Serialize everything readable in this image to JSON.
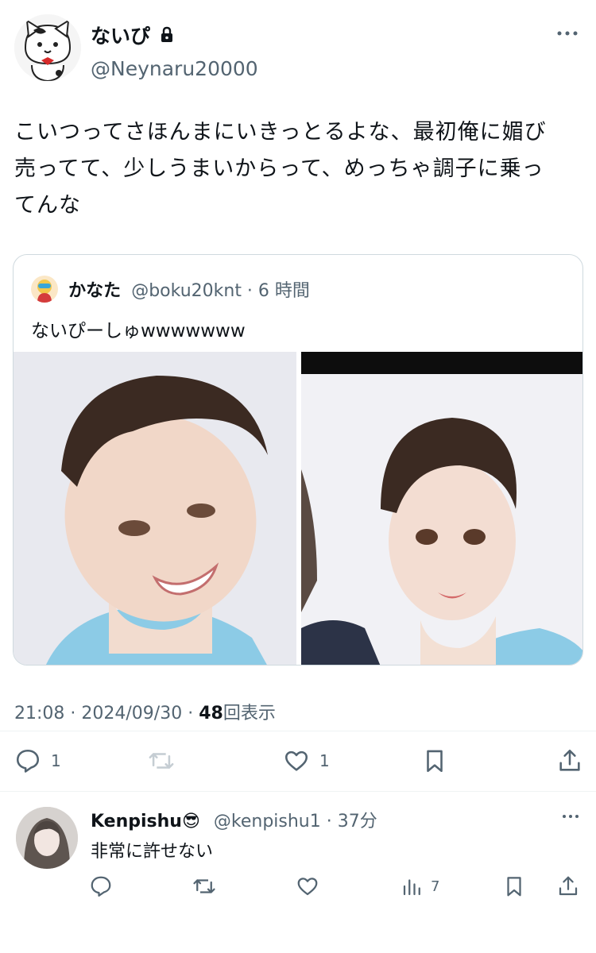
{
  "post": {
    "display_name": "ないぴ",
    "handle": "@Neynaru20000",
    "text_lines": [
      "こいつってさほんまにいきっとるよな、最初俺に媚び",
      "売ってて、少しうまいからって、めっちゃ調子に乗っ",
      "てんな"
    ],
    "icons": {
      "lock": "lock-icon",
      "more": "more-horizontal-icon"
    }
  },
  "quote": {
    "display_name": "かなた",
    "meta": "@boku20knt · 6 時間",
    "text": "ないぴーしゅwwwwwww"
  },
  "meta": {
    "time": "21:08",
    "date": "2024/09/30",
    "views": "48",
    "views_label": "回表示",
    "separator": "·"
  },
  "actions": {
    "reply_count": "1",
    "retweet_count": "",
    "like_count": "1"
  },
  "reply": {
    "display_name": "Kenpishu😎",
    "meta": "@kenpishu1 · 37分",
    "text": "非常に許せない",
    "views_count": "7"
  },
  "colors": {
    "text": "#0f1419",
    "secondary": "#536471",
    "border": "#cfd9de",
    "divider": "#eff3f4"
  }
}
